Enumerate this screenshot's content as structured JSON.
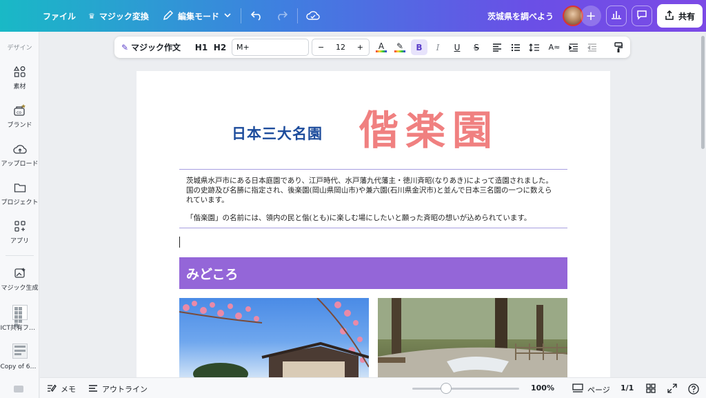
{
  "topbar": {
    "file_label": "ファイル",
    "magic_switch_label": "マジック変換",
    "edit_mode_label": "編集モード",
    "doc_title": "茨城県を調べよう",
    "share_label": "共有"
  },
  "sidebar": {
    "heading": "デザイン",
    "items": [
      {
        "label": "素材"
      },
      {
        "label": "ブランド"
      },
      {
        "label": "アップロード"
      },
      {
        "label": "プロジェクト"
      },
      {
        "label": "アプリ"
      },
      {
        "label": "マジック生成"
      },
      {
        "label": "ICT共有フォ…"
      },
      {
        "label": "Copy of 6年…"
      }
    ]
  },
  "format_toolbar": {
    "magic_write_label": "マジック作文",
    "h1_label": "H1",
    "h2_label": "H2",
    "font_name": "M+",
    "font_size": "12",
    "minus": "−",
    "plus": "+",
    "bold": "B",
    "italic": "I",
    "underline": "U",
    "strike": "S"
  },
  "document": {
    "logo_left": "日本三大名園",
    "logo_right": "偕楽園",
    "paragraph1": "茨城県水戸市にある日本庭園であり、江戸時代、水戸藩九代藩主・徳川斉昭(なりあき)によって造園されました。国の史跡及び名勝に指定され、後楽園(岡山県岡山市)や兼六園(石川県金沢市)と並んで日本三名園の一つに数えられています。",
    "paragraph2": "「偕楽園」の名前には、領内の民と偕(とも)に楽しむ場にしたいと願った斉昭の想いが込められています。",
    "section_title": "みどころ"
  },
  "bottombar": {
    "memo_label": "メモ",
    "outline_label": "アウトライン",
    "zoom": "100%",
    "page_label": "ページ",
    "page_count": "1/1"
  },
  "colors": {
    "accent_purple": "#9466d8",
    "logo_blue": "#1d4c9c",
    "logo_pink": "#f08080"
  }
}
